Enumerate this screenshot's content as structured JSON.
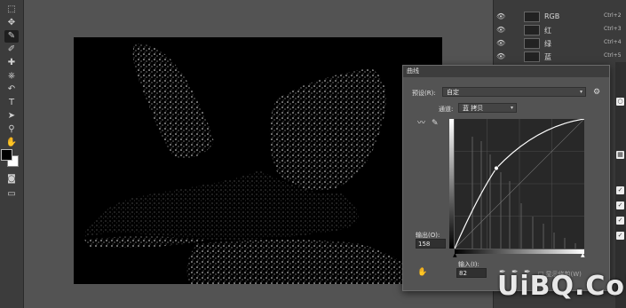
{
  "toolbar": {
    "tools": [
      "marquee-tool",
      "move-tool",
      "lasso-tool",
      "brush-tool",
      "eyedropper-tool",
      "healing-tool",
      "clone-tool",
      "history-brush-tool",
      "eraser-tool",
      "gradient-tool",
      "blur-tool",
      "dodge-tool",
      "pen-tool",
      "type-tool",
      "path-select-tool",
      "shape-tool",
      "hand-tool",
      "zoom-tool"
    ],
    "foreground_color": "#000000",
    "background_color": "#ffffff"
  },
  "channels": [
    {
      "name": "RGB",
      "shortcut": "Ctrl+2"
    },
    {
      "name": "红",
      "shortcut": "Ctrl+3"
    },
    {
      "name": "绿",
      "shortcut": "Ctrl+4"
    },
    {
      "name": "蓝",
      "shortcut": "Ctrl+5"
    }
  ],
  "curves": {
    "title": "曲线",
    "preset_label": "预设(R):",
    "preset_value": "自定",
    "channel_label": "通道:",
    "channel_value": "蓝 拷贝",
    "output_label": "输出(O):",
    "output_value": "158",
    "input_label": "输入(I):",
    "input_value": "82",
    "show_clipping_label": "显示修剪(W)",
    "point": {
      "input": 82,
      "output": 158
    }
  },
  "watermark": "UiBQ.CoM"
}
